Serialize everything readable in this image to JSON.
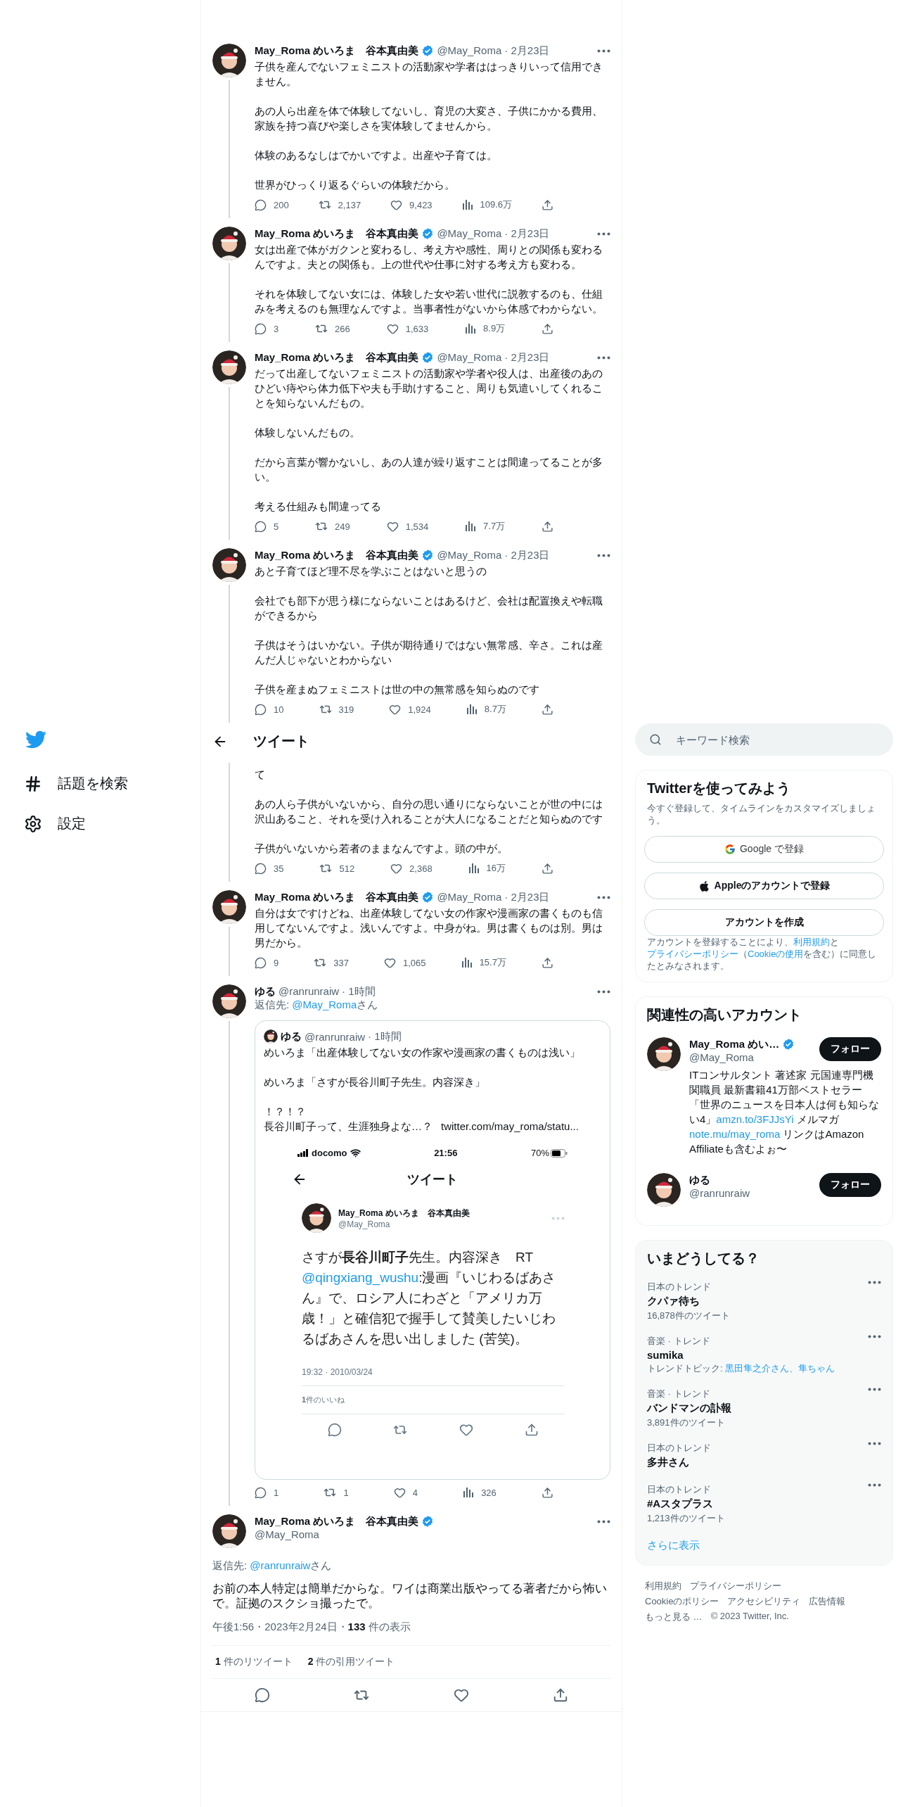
{
  "nav": {
    "items": [
      {
        "kind": "explore",
        "label": "話題を検索"
      },
      {
        "kind": "settings",
        "label": "設定"
      }
    ]
  },
  "header": {
    "title": "ツイート"
  },
  "thread": [
    {
      "kind": "tweet",
      "author": {
        "name": "May_Roma めいろま　谷本真由美",
        "verified": true,
        "handle": "@May_Roma"
      },
      "date": "· 2月23日",
      "paragraphs": [
        "子供を産んでないフェミニストの活動家や学者ははっきりいって信用できません。",
        "あの人ら出産を体で体験してないし、育児の大変さ、子供にかかる費用、家族を持つ喜びや楽しさを実体験してませんから。",
        "体験のあるなしはでかいですよ。出産や子育ては。",
        "世界がひっくり返るぐらいの体験だから。"
      ],
      "stats": {
        "replies": "200",
        "retweets": "2,137",
        "likes": "9,423",
        "views": "109.6万"
      }
    },
    {
      "kind": "tweet",
      "author": {
        "name": "May_Roma めいろま　谷本真由美",
        "verified": true,
        "handle": "@May_Roma"
      },
      "date": "· 2月23日",
      "paragraphs": [
        "女は出産で体がガクンと変わるし、考え方や感性、周りとの関係も変わるんですよ。夫との関係も。上の世代や仕事に対する考え方も変わる。",
        "それを体験してない女には、体験した女や若い世代に説教するのも、仕組みを考えるのも無理なんですよ。当事者性がないから体感でわからない。"
      ],
      "stats": {
        "replies": "3",
        "retweets": "266",
        "likes": "1,633",
        "views": "8.9万"
      }
    },
    {
      "kind": "tweet",
      "author": {
        "name": "May_Roma めいろま　谷本真由美",
        "verified": true,
        "handle": "@May_Roma"
      },
      "date": "· 2月23日",
      "paragraphs": [
        "だって出産してないフェミニストの活動家や学者や役人は、出産後のあのひどい痔やら体力低下や夫も手助けすること、周りも気遣いしてくれることを知らないんだもの。",
        "体験しないんだもの。",
        "だから言葉が響かないし、あの人達が繰り返すことは間違ってることが多い。",
        "考える仕組みも間違ってる"
      ],
      "stats": {
        "replies": "5",
        "retweets": "249",
        "likes": "1,534",
        "views": "7.7万"
      }
    },
    {
      "kind": "tweet",
      "author": {
        "name": "May_Roma めいろま　谷本真由美",
        "verified": true,
        "handle": "@May_Roma"
      },
      "date": "· 2月23日",
      "paragraphs": [
        "あと子育てほど理不尽を学ぶことはないと思うの",
        "会社でも部下が思う様にならないことはあるけど、会社は配置換えや転職ができるから",
        "子供はそうはいかない。子供が期待通りではない無常感、辛さ。これは産んだ人じゃないとわからない",
        "子供を産まぬフェミニストは世の中の無常感を知らぬのです"
      ],
      "stats": {
        "replies": "10",
        "retweets": "319",
        "likes": "1,924",
        "views": "8.7万"
      }
    },
    {
      "kind": "header"
    },
    {
      "kind": "partial",
      "paragraphs": [
        "て",
        "あの人ら子供がいないから、自分の思い通りにならないことが世の中には沢山あること、それを受け入れることが大人になることだと知らぬのです",
        "子供がいないから若者のままなんですよ。頭の中が。"
      ],
      "stats": {
        "replies": "35",
        "retweets": "512",
        "likes": "2,368",
        "views": "16万"
      }
    },
    {
      "kind": "tweet",
      "author": {
        "name": "May_Roma めいろま　谷本真由美",
        "verified": true,
        "handle": "@May_Roma"
      },
      "date": "· 2月23日",
      "paragraphs": [
        "自分は女ですけどね、出産体験してない女の作家や漫画家の書くものも信用してないんですよ。浅いんですよ。中身がね。男は書くものは別。男は男だから。"
      ],
      "stats": {
        "replies": "9",
        "retweets": "337",
        "likes": "1,065",
        "views": "15.7万"
      }
    },
    {
      "kind": "tweet",
      "author": {
        "name": "ゆる",
        "verified": false,
        "handle": "@ranrunraiw"
      },
      "date": "· 1時間",
      "reply_to": {
        "label": "返信先:",
        "handle": "@May_Roma",
        "suffix": "さん"
      },
      "quote": {
        "author": {
          "name": "ゆる",
          "handle": "@ranrunraiw"
        },
        "date": "· 1時間",
        "paragraphs": [
          [
            "めいろま「出産体験してない女の作家や漫画家の書くものは浅い」"
          ],
          [
            "めいろま「さすが長谷川町子先生。内容深き」"
          ],
          [
            "！？！？",
            "長谷川町子って、生涯独身よな…？"
          ]
        ],
        "link": "twitter.com/may_roma/statu...",
        "screenshot": {
          "carrier": "docomo",
          "time": "21:56",
          "battery": "70%",
          "title": "ツイート",
          "author": {
            "name": "May_Roma めいろま　谷本真由美",
            "handle": "@May_Roma"
          },
          "text_before": "さすが**長谷川町子**先生。内容深き　RT ",
          "mention": "@qingxiang_wushu",
          "text_after": ":漫画『いじわるばあさん』で、ロシア人にわざと「アメリカ万歳！」と確信犯で握手して賛美したいじわるばあさんを思い出しました (苦笑)。",
          "timestamp": "19:32 · 2010/03/24",
          "likes": "**1**件のいいね"
        }
      },
      "stats": {
        "replies": "1",
        "retweets": "1",
        "likes": "4",
        "views": "326"
      }
    }
  ],
  "focused": {
    "author": {
      "name": "May_Roma めいろま　谷本真由美",
      "verified": true,
      "handle": "@May_Roma"
    },
    "reply_to": {
      "label": "返信先:",
      "handle": "@ranrunraiw",
      "suffix": "さん"
    },
    "text": "お前の本人特定は簡単だからな。ワイは商業出版やってる著者だから怖いで。証拠のスクショ撮ったで。",
    "meta": "午後1:56・2023年2月24日・**133** 件の表示",
    "counts": [
      "**1** 件のリツイート",
      "**2** 件の引用ツイート"
    ]
  },
  "sidebar": {
    "search": {
      "placeholder": "キーワード検索"
    },
    "signup": {
      "title": "Twitterを使ってみよう",
      "subtitle": "今すぐ登録して、タイムラインをカスタマイズしましょう。",
      "buttons": [
        {
          "kind": "google",
          "label": "Google で登録"
        },
        {
          "kind": "apple",
          "label": "Appleのアカウントで登録"
        },
        {
          "kind": "plain",
          "label": "アカウントを作成"
        }
      ],
      "legal": [
        {
          "text": "アカウントを登録することにより、",
          "link": false
        },
        {
          "text": "利用規約",
          "link": true
        },
        {
          "text": "と",
          "link": false
        },
        {
          "text": "プライバシーポリシー",
          "link": true
        },
        {
          "text": "（",
          "link": false
        },
        {
          "text": "Cookieの使用",
          "link": true
        },
        {
          "text": "を含む）に同意したとみなされます。",
          "link": false
        }
      ]
    },
    "related": {
      "title": "関連性の高いアカウント",
      "accounts": [
        {
          "name": "May_Roma めい…",
          "verified": true,
          "handle": "@May_Roma",
          "button": "フォロー",
          "bio": [
            {
              "text": "ITコンサルタント 著述家 元国連専門機関職員 最新書籍41万部ベストセラー「世界のニュースを日本人は何も知らない4」",
              "link": false
            },
            {
              "text": "amzn.to/3FJJsYi",
              "link": true
            },
            {
              "text": " メルマガ ",
              "link": false
            },
            {
              "text": "note.mu/may_roma",
              "link": true
            },
            {
              "text": " リンクはAmazon Affiliateも含むよぉ〜",
              "link": false
            }
          ]
        },
        {
          "name": "ゆる",
          "verified": false,
          "handle": "@ranrunraiw",
          "button": "フォロー"
        }
      ]
    },
    "trends": {
      "title": "いまどうしてる？",
      "items": [
        {
          "context": "日本のトレンド",
          "name": "クパァ待ち",
          "count": "16,878件のツイート"
        },
        {
          "context": "音楽 · トレンド",
          "name": "sumika",
          "topic_label": "トレンドトピック:",
          "topic": "黒田隼之介さん、隼ちゃん"
        },
        {
          "context": "音楽 · トレンド",
          "name": "バンドマンの訃報",
          "count": "3,891件のツイート"
        },
        {
          "context": "日本のトレンド",
          "name": "多井さん"
        },
        {
          "context": "日本のトレンド",
          "name": "#Aスタプラス",
          "count": "1,213件のツイート"
        }
      ],
      "more": "さらに表示"
    },
    "footer": {
      "links": [
        "利用規約",
        "プライバシーポリシー",
        "Cookieのポリシー",
        "アクセシビリティ",
        "広告情報",
        "もっと見る …"
      ],
      "copyright": "© 2023 Twitter, Inc."
    }
  }
}
